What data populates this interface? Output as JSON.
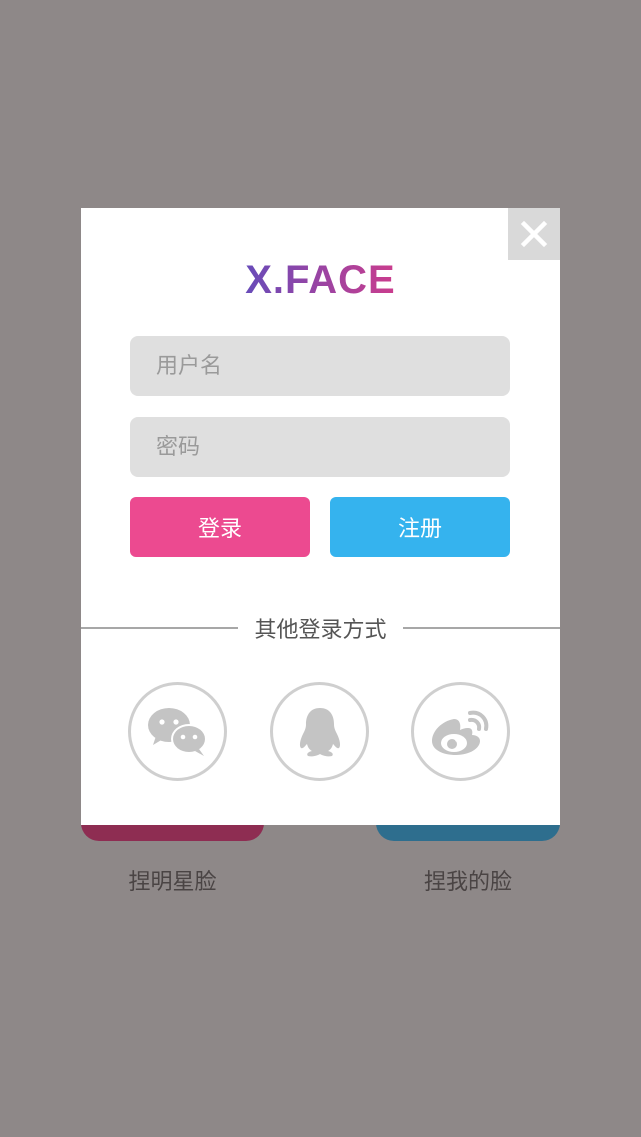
{
  "background": {
    "left_label": "捏明星脸",
    "right_label": "捏我的脸"
  },
  "modal": {
    "logo": "X.FACE",
    "username_placeholder": "用户名",
    "password_placeholder": "密码",
    "login_label": "登录",
    "register_label": "注册",
    "other_login_label": "其他登录方式",
    "social_icons": [
      "wechat-icon",
      "qq-icon",
      "weibo-icon"
    ]
  },
  "colors": {
    "overlay": "#8e8888",
    "login_button": "#ec4a90",
    "register_button": "#35b3ee",
    "input_bg": "#dfdfdf",
    "icon_gray": "#c4c4c4"
  }
}
